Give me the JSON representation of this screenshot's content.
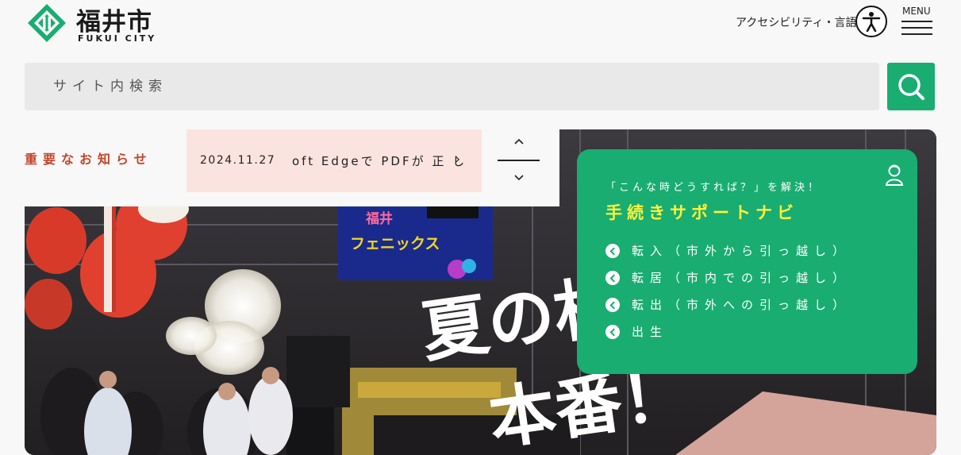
{
  "header": {
    "logo_text": "福井市",
    "logo_sub": "FUKUI CITY",
    "accessibility_label": "アクセシビリティ・言語",
    "menu_label": "MENU"
  },
  "search": {
    "placeholder": "サイト内検索"
  },
  "notice": {
    "label": "重要なお知らせ",
    "date": "2024.11.27",
    "text": "oft Edgeで PDFが 正 し"
  },
  "hero": {
    "headline_1": "夏の村",
    "headline_2": "本番！",
    "sign_top": "福井",
    "sign_main": "フェニックス"
  },
  "navi": {
    "subtitle": "「こんな時どうすれば？」を解決！",
    "title": "手続きサポートナビ",
    "items": [
      {
        "label": "転入（市外から引っ越し）"
      },
      {
        "label": "転居（市内での引っ越し）"
      },
      {
        "label": "転出（市外への引っ越し）"
      },
      {
        "label": "出生"
      }
    ]
  },
  "colors": {
    "brand_green": "#19ad71",
    "notice_red": "#c4452b",
    "notice_bg": "#fbe4df",
    "navi_title": "#fff23a"
  },
  "icons": {
    "logo": "fukui-city-emblem-icon",
    "accessibility": "accessibility-person-icon",
    "search": "search-icon",
    "menu": "hamburger-menu-icon",
    "notice_prev": "chevron-up-icon",
    "notice_next": "chevron-down-icon",
    "navi": "person-support-icon"
  }
}
